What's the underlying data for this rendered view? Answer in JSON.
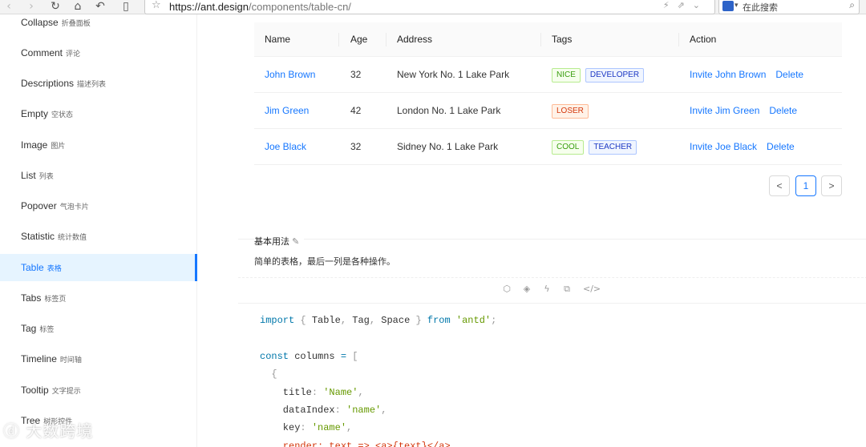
{
  "browser": {
    "url_host": "https://ant.design",
    "url_path": "/components/table-cn/",
    "search_placeholder": "在此搜索"
  },
  "sidebar": {
    "items": [
      {
        "label": "Collapse",
        "zh": "折叠面板"
      },
      {
        "label": "Comment",
        "zh": "评论"
      },
      {
        "label": "Descriptions",
        "zh": "描述列表"
      },
      {
        "label": "Empty",
        "zh": "空状态"
      },
      {
        "label": "Image",
        "zh": "图片"
      },
      {
        "label": "List",
        "zh": "列表"
      },
      {
        "label": "Popover",
        "zh": "气泡卡片"
      },
      {
        "label": "Statistic",
        "zh": "统计数值"
      },
      {
        "label": "Table",
        "zh": "表格",
        "active": true
      },
      {
        "label": "Tabs",
        "zh": "标签页"
      },
      {
        "label": "Tag",
        "zh": "标签"
      },
      {
        "label": "Timeline",
        "zh": "时间轴"
      },
      {
        "label": "Tooltip",
        "zh": "文字提示"
      },
      {
        "label": "Tree",
        "zh": "树形控件"
      }
    ]
  },
  "table": {
    "headers": [
      "Name",
      "Age",
      "Address",
      "Tags",
      "Action"
    ],
    "rows": [
      {
        "name": "John Brown",
        "age": "32",
        "address": "New York No. 1 Lake Park",
        "tags": [
          {
            "text": "NICE",
            "color": "green"
          },
          {
            "text": "DEVELOPER",
            "color": "geekblue"
          }
        ],
        "invite": "Invite John Brown",
        "delete": "Delete"
      },
      {
        "name": "Jim Green",
        "age": "42",
        "address": "London No. 1 Lake Park",
        "tags": [
          {
            "text": "LOSER",
            "color": "volcano"
          }
        ],
        "invite": "Invite Jim Green",
        "delete": "Delete"
      },
      {
        "name": "Joe Black",
        "age": "32",
        "address": "Sidney No. 1 Lake Park",
        "tags": [
          {
            "text": "COOL",
            "color": "green"
          },
          {
            "text": "TEACHER",
            "color": "geekblue"
          }
        ],
        "invite": "Invite Joe Black",
        "delete": "Delete"
      }
    ]
  },
  "pagination": {
    "prev": "<",
    "page": "1",
    "next": ">"
  },
  "demo": {
    "title": "基本用法",
    "description": "简单的表格，最后一列是各种操作。"
  },
  "code": [
    "import { Table, Tag, Space } from 'antd';",
    "",
    "const columns = [",
    "  {",
    "    title: 'Name',",
    "    dataIndex: 'name',",
    "    key: 'name',",
    "    render: text => <a>{text}</a>,"
  ],
  "watermark": "大数跨境",
  "colors": {
    "accent": "#1677ff",
    "active_bg": "#e6f4ff"
  }
}
